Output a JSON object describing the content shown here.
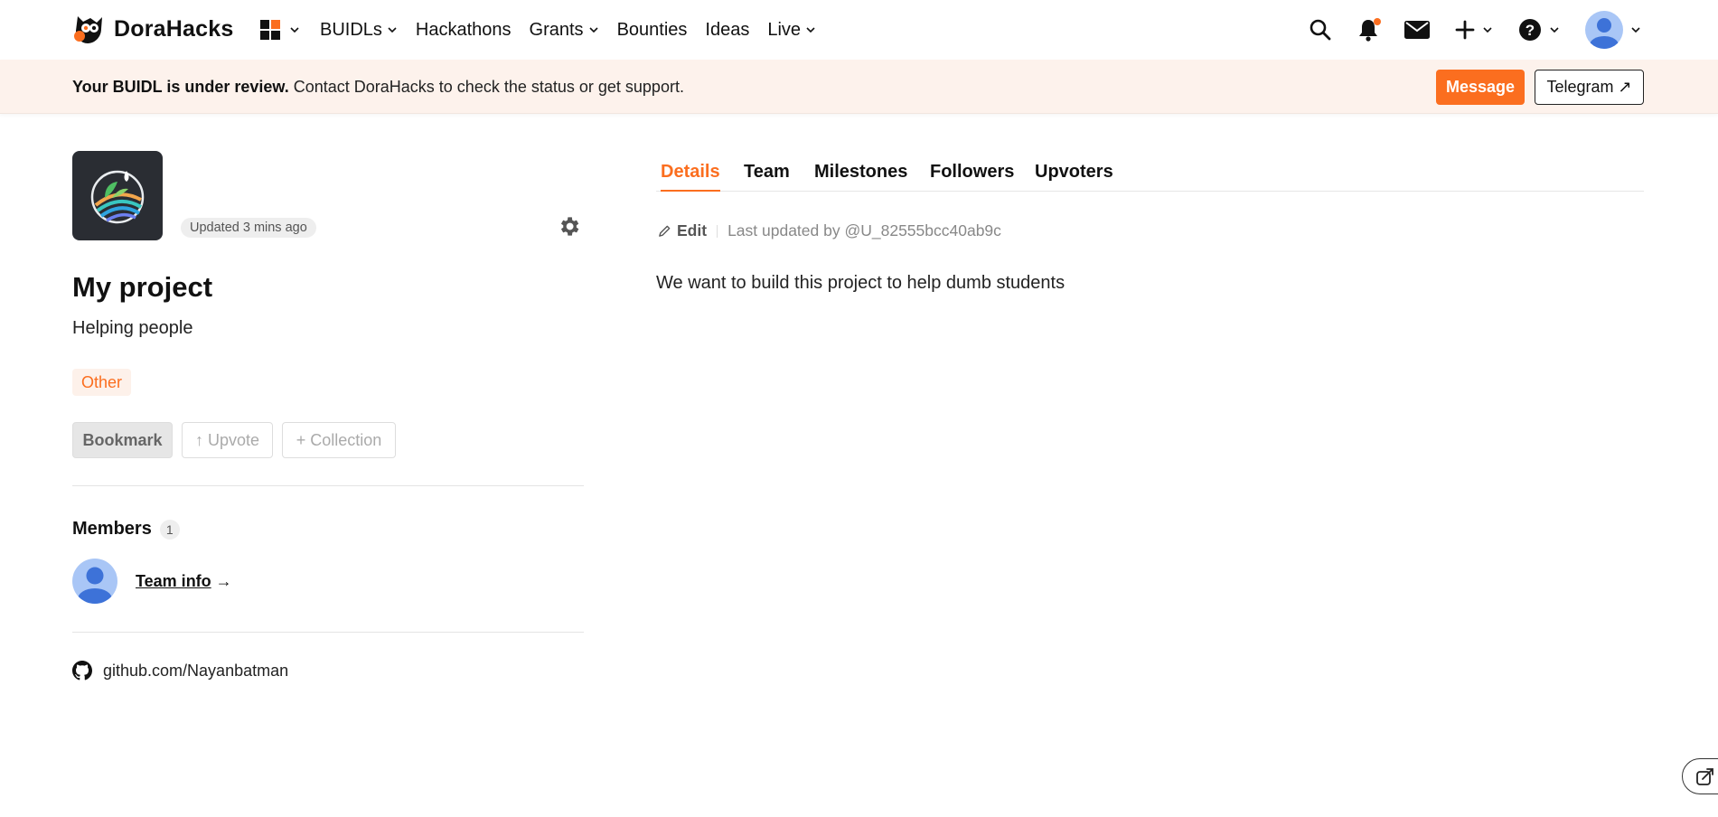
{
  "header": {
    "brand": "DoraHacks",
    "nav": [
      {
        "label": "BUIDLs",
        "has_dropdown": true
      },
      {
        "label": "Hackathons",
        "has_dropdown": false
      },
      {
        "label": "Grants",
        "has_dropdown": true
      },
      {
        "label": "Bounties",
        "has_dropdown": false
      },
      {
        "label": "Ideas",
        "has_dropdown": false
      },
      {
        "label": "Live",
        "has_dropdown": true
      }
    ],
    "icons": [
      "apps-grid-icon",
      "search-icon",
      "bell-icon",
      "mail-icon",
      "plus-icon",
      "help-icon",
      "avatar"
    ]
  },
  "banner": {
    "bold_text": "Your BUIDL is under review.",
    "text": " Contact DoraHacks to check the status or get support.",
    "message_label": "Message",
    "telegram_label": "Telegram ↗"
  },
  "project": {
    "updated": "Updated 3 mins ago",
    "title": "My project",
    "subtitle": "Helping people",
    "tag": "Other",
    "actions": {
      "bookmark": "Bookmark",
      "upvote": "↑ Upvote",
      "collection": "+ Collection"
    },
    "members_label": "Members",
    "members_count": "1",
    "team_info": "Team info",
    "team_arrow": " →",
    "github": "github.com/Nayanbatman"
  },
  "tabs": [
    "Details",
    "Team",
    "Milestones",
    "Followers",
    "Upvoters"
  ],
  "details": {
    "edit_label": "Edit",
    "last_updated": "Last updated by @U_82555bcc40ab9c",
    "description": "We want to build this project to help dumb students"
  },
  "colors": {
    "accent": "#fb6e1f",
    "banner_bg": "#fdf2ec",
    "avatar_bg": "#a9c6f6",
    "avatar_fg": "#3d72d8"
  }
}
